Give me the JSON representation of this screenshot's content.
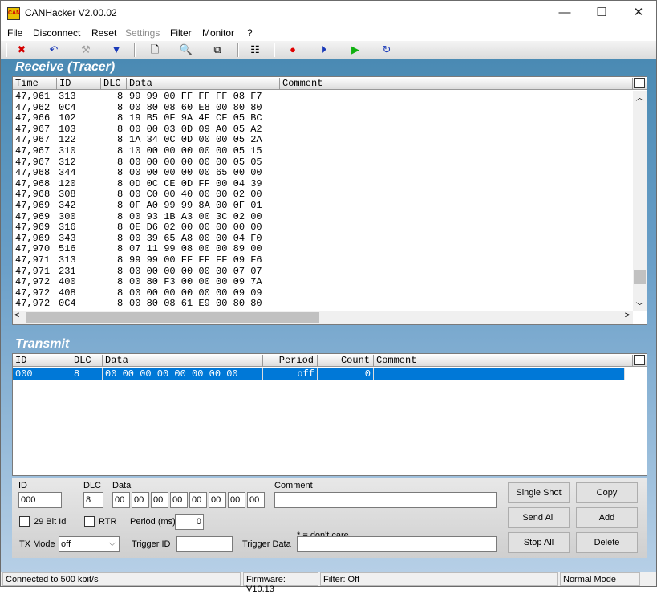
{
  "window": {
    "title": "CANHacker V2.00.02",
    "minimize": "—",
    "maximize": "☐",
    "close": "✕"
  },
  "menu": [
    "File",
    "Disconnect",
    "Reset",
    "Settings",
    "Filter",
    "Monitor",
    "?"
  ],
  "toolbar": [
    {
      "icon": "disconnect-icon",
      "glyph": "✖",
      "color": "#d40000"
    },
    {
      "icon": "undo-icon",
      "glyph": "↶",
      "color": "#1a3ab8"
    },
    {
      "icon": "tools-icon",
      "glyph": "⚒",
      "color": "#a0a0a0"
    },
    {
      "icon": "filter-icon",
      "glyph": "▼",
      "color": "#1a3ab8"
    },
    {
      "icon": "new-file-icon",
      "glyph": "🗋",
      "color": "#000"
    },
    {
      "icon": "preview-icon",
      "glyph": "🔍",
      "color": "#000"
    },
    {
      "icon": "copy-icon",
      "glyph": "⧉",
      "color": "#000"
    },
    {
      "icon": "list-settings-icon",
      "glyph": "☷",
      "color": "#000"
    },
    {
      "icon": "record-icon",
      "glyph": "●",
      "color": "#e00000"
    },
    {
      "icon": "step-icon",
      "glyph": "⏵",
      "color": "#1a3ab8"
    },
    {
      "icon": "play-icon",
      "glyph": "▶",
      "color": "#10b010"
    },
    {
      "icon": "loop-icon",
      "glyph": "↻",
      "color": "#1a3ab8"
    }
  ],
  "receive": {
    "title": "Receive (Tracer)",
    "columns": [
      "Time",
      "ID",
      "DLC",
      "Data",
      "Comment"
    ],
    "rows": [
      [
        "47,961",
        "313",
        "8",
        "99 99 00 FF FF FF 08 F7"
      ],
      [
        "47,962",
        "0C4",
        "8",
        "00 80 08 60 E8 00 80 80"
      ],
      [
        "47,966",
        "102",
        "8",
        "19 B5 0F 9A 4F CF 05 BC"
      ],
      [
        "47,967",
        "103",
        "8",
        "00 00 03 0D 09 A0 05 A2"
      ],
      [
        "47,967",
        "122",
        "8",
        "1A 34 0C 0D 00 00 05 2A"
      ],
      [
        "47,967",
        "310",
        "8",
        "10 00 00 00 00 00 05 15"
      ],
      [
        "47,967",
        "312",
        "8",
        "00 00 00 00 00 00 05 05"
      ],
      [
        "47,968",
        "344",
        "8",
        "00 00 00 00 00 65 00 00"
      ],
      [
        "47,968",
        "120",
        "8",
        "0D 0C CE 0D FF 00 04 39"
      ],
      [
        "47,968",
        "308",
        "8",
        "00 C0 00 40 00 00 02 00"
      ],
      [
        "47,969",
        "342",
        "8",
        "0F A0 99 99 8A 00 0F 01"
      ],
      [
        "47,969",
        "300",
        "8",
        "00 93 1B A3 00 3C 02 00"
      ],
      [
        "47,969",
        "316",
        "8",
        "0E D6 02 00 00 00 00 00"
      ],
      [
        "47,969",
        "343",
        "8",
        "00 39 65 A8 00 00 04 F0"
      ],
      [
        "47,970",
        "516",
        "8",
        "07 11 99 08 00 00 89 00"
      ],
      [
        "47,971",
        "313",
        "8",
        "99 99 00 FF FF FF 09 F6"
      ],
      [
        "47,971",
        "231",
        "8",
        "00 00 00 00 00 00 07 07"
      ],
      [
        "47,972",
        "400",
        "8",
        "00 80 F3 00 00 00 09 7A"
      ],
      [
        "47,972",
        "408",
        "8",
        "00 00 00 00 00 00 09 09"
      ],
      [
        "47,972",
        "0C4",
        "8",
        "00 80 08 61 E9 00 80 80"
      ]
    ]
  },
  "transmit": {
    "title": "Transmit",
    "columns": [
      "ID",
      "DLC",
      "Data",
      "Period",
      "Count",
      "Comment"
    ],
    "rows": [
      [
        "000",
        "8",
        "00 00 00 00 00 00 00 00",
        "off",
        "0",
        ""
      ]
    ]
  },
  "form": {
    "id_label": "ID",
    "id_value": "000",
    "dlc_label": "DLC",
    "dlc_value": "8",
    "data_label": "Data",
    "data_values": [
      "00",
      "00",
      "00",
      "00",
      "00",
      "00",
      "00",
      "00"
    ],
    "comment_label": "Comment",
    "comment_value": "",
    "bit29_label": "29 Bit Id",
    "rtr_label": "RTR",
    "period_label": "Period (ms)",
    "period_value": "0",
    "dont_care": "* = don't care",
    "txmode_label": "TX Mode",
    "txmode_value": "off",
    "trigger_id_label": "Trigger ID",
    "trigger_data_label": "Trigger Data",
    "buttons": {
      "single_shot": "Single Shot",
      "copy": "Copy",
      "send_all": "Send All",
      "add": "Add",
      "stop_all": "Stop All",
      "delete": "Delete"
    }
  },
  "status": {
    "connection": "Connected to 500 kbit/s",
    "firmware": "Firmware: V10.13",
    "filter": "Filter: Off",
    "mode": "Normal Mode"
  }
}
